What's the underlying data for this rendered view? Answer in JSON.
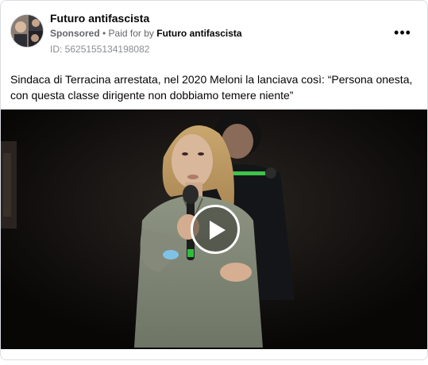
{
  "post": {
    "page_name": "Futuro antifascista",
    "sponsored_label": "Sponsored",
    "separator": " • ",
    "paid_for_prefix": "Paid for by ",
    "paid_for_name": "Futuro antifascista",
    "ad_id": "ID: 5625155134198082",
    "more_icon": "more-horizontal-icon",
    "more_label": "•••",
    "text": "Sindaca di Terracina arrestata, nel 2020 Meloni la lanciava così: “Persona onesta, con questa classe dirigente non dobbiamo temere niente”"
  },
  "media": {
    "type": "video",
    "play_icon": "play-icon"
  },
  "colors": {
    "text_primary": "#050505",
    "text_secondary": "#65676b",
    "border": "#dadde1",
    "video_bg": "#0b0908"
  }
}
